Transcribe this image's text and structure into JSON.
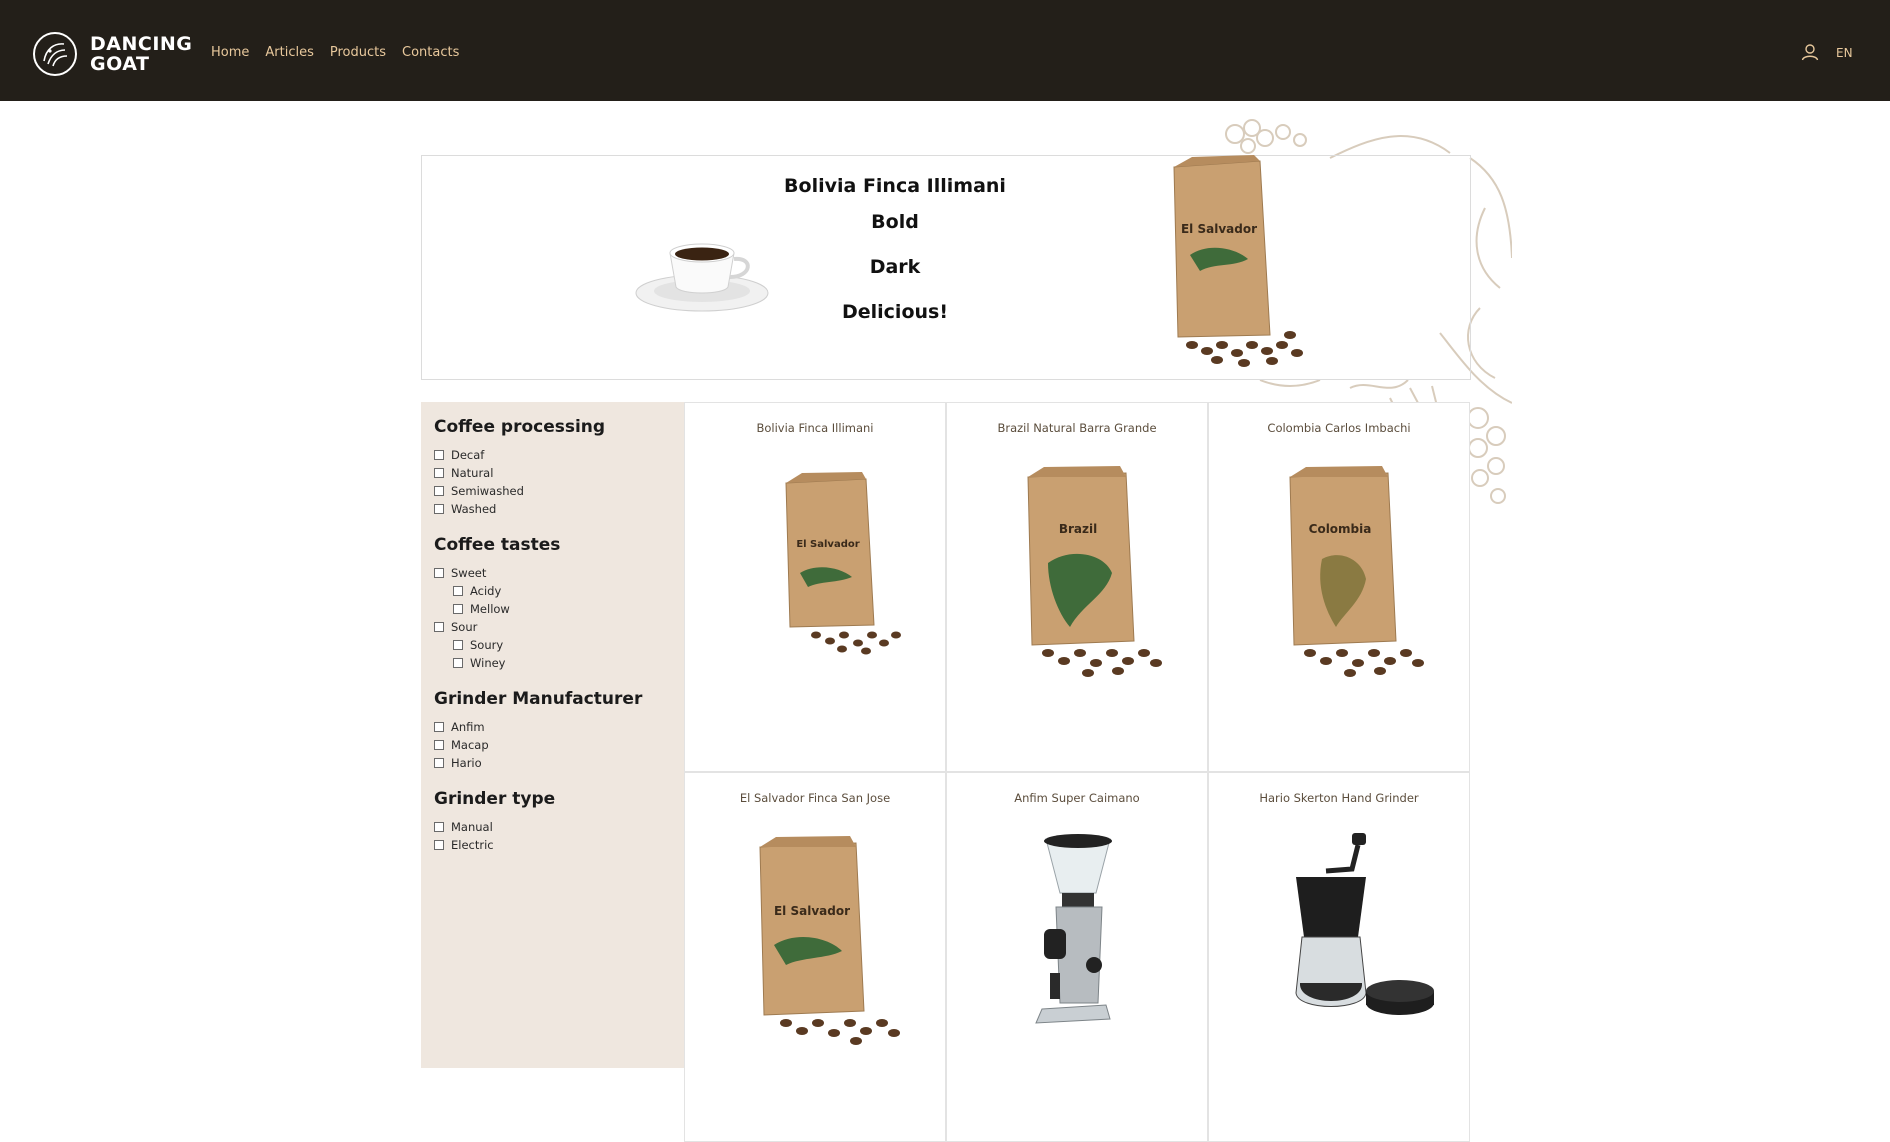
{
  "header": {
    "brand_line1": "DANCING",
    "brand_line2": "GOAT",
    "nav": [
      "Home",
      "Articles",
      "Products",
      "Contacts"
    ],
    "language": "EN",
    "user_icon": "user-icon",
    "logo_icon": "goat-logo-icon"
  },
  "hero": {
    "title": "Bolivia Finca Illimani",
    "lines": [
      "Bold",
      "Dark",
      "Delicious!"
    ],
    "bag_label": "El Salvador"
  },
  "filters": [
    {
      "title": "Coffee processing",
      "options": [
        {
          "label": "Decaf"
        },
        {
          "label": "Natural"
        },
        {
          "label": "Semiwashed"
        },
        {
          "label": "Washed"
        }
      ]
    },
    {
      "title": "Coffee tastes",
      "options": [
        {
          "label": "Sweet"
        },
        {
          "label": "Acidy",
          "sub": true
        },
        {
          "label": "Mellow",
          "sub": true
        },
        {
          "label": "Sour"
        },
        {
          "label": "Soury",
          "sub": true
        },
        {
          "label": "Winey",
          "sub": true
        }
      ]
    },
    {
      "title": "Grinder Manufacturer",
      "options": [
        {
          "label": "Anfim"
        },
        {
          "label": "Macap"
        },
        {
          "label": "Hario"
        }
      ]
    },
    {
      "title": "Grinder type",
      "options": [
        {
          "label": "Manual"
        },
        {
          "label": "Electric"
        }
      ]
    }
  ],
  "products": [
    {
      "name": "Bolivia Finca Illimani",
      "image": "coffee-bag",
      "bag_label": "El Salvador"
    },
    {
      "name": "Brazil Natural Barra Grande",
      "image": "coffee-bag",
      "bag_label": "Brazil"
    },
    {
      "name": "Colombia Carlos Imbachi",
      "image": "coffee-bag",
      "bag_label": "Colombia"
    },
    {
      "name": "El Salvador Finca San Jose",
      "image": "coffee-bag",
      "bag_label": "El Salvador"
    },
    {
      "name": "Anfim Super Caimano",
      "image": "espresso-grinder"
    },
    {
      "name": "Hario Skerton Hand Grinder",
      "image": "hand-grinder"
    }
  ],
  "colors": {
    "header_bg": "#231f19",
    "nav_link": "#e8c89c",
    "sidebar_bg": "#efe7df",
    "kraft": "#c9a071",
    "map_green": "#3f6b3a",
    "product_name": "#5b4d3c"
  }
}
